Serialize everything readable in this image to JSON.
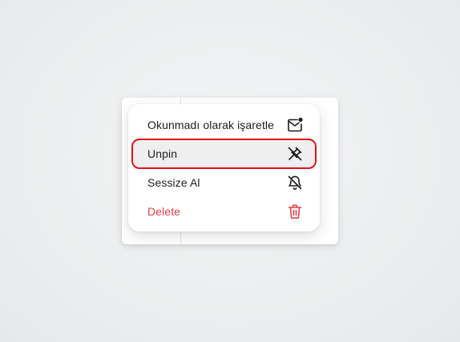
{
  "context_menu": {
    "items": [
      {
        "label": "Okunmadı olarak işaretle",
        "icon": "mail-unread-icon",
        "danger": false,
        "highlighted": false
      },
      {
        "label": "Unpin",
        "icon": "unpin-icon",
        "danger": false,
        "highlighted": true
      },
      {
        "label": "Sessize Al",
        "icon": "bell-off-icon",
        "danger": false,
        "highlighted": false
      },
      {
        "label": "Delete",
        "icon": "trash-icon",
        "danger": true,
        "highlighted": false
      }
    ]
  },
  "colors": {
    "text": "#1c1c1e",
    "danger": "#e0414b",
    "highlight_border": "#e2121b",
    "highlight_bg": "#efeff0"
  }
}
